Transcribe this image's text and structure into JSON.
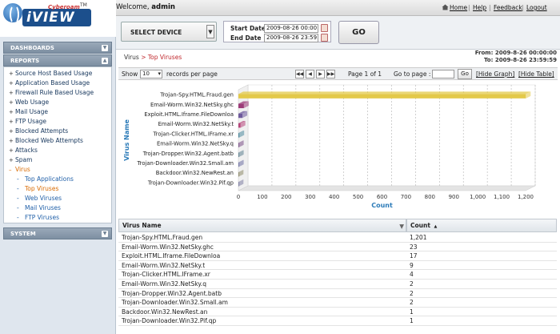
{
  "brand": {
    "name": "iVIEW",
    "maker": "Cyberoam",
    "tm": "TM"
  },
  "topbar": {
    "welcome_prefix": "Welcome,",
    "user": "admin",
    "links": [
      "Home",
      "Help",
      "Feedback",
      "Logout"
    ]
  },
  "sidebar": {
    "dashboards": "DASHBOARDS",
    "reports": "REPORTS",
    "system": "SYSTEM",
    "items": [
      "Source Host Based Usage",
      "Application Based Usage",
      "Firewall Rule Based Usage",
      "Web Usage",
      "Mail Usage",
      "FTP Usage",
      "Blocked Attempts",
      "Blocked Web Attempts",
      "Attacks",
      "Spam",
      "Virus"
    ],
    "virus_sub": [
      "Top Applications",
      "Top Viruses",
      "Web Viruses",
      "Mail Viruses",
      "FTP Viruses"
    ]
  },
  "selection": {
    "device_label": "SELECT DEVICE",
    "start_label": "Start Date",
    "start_value": "2009-08-26 00:00:00",
    "end_label": "End Date",
    "end_value": "2009-08-26 23:59:59",
    "go_label": "GO"
  },
  "report": {
    "crumb_parent": "Virus",
    "crumb_sep": ">",
    "crumb_current": "Top Viruses",
    "from": "From: 2009-8-26 00:00:00",
    "to": "To: 2009-8-26 23:59:59"
  },
  "pager": {
    "show": "Show",
    "per_page_value": "10",
    "records_label": "records per page",
    "page_info": "Page 1 of 1",
    "goto_label": "Go to page :",
    "go_btn": "Go",
    "hide_graph": "[Hide Graph]",
    "hide_table": "[Hide Table]"
  },
  "chart_data": {
    "type": "bar",
    "orientation": "horizontal",
    "title": "",
    "xlabel": "Count",
    "ylabel": "Virus Name",
    "xlim": [
      0,
      1200
    ],
    "xticks": [
      0,
      100,
      200,
      300,
      400,
      500,
      600,
      700,
      800,
      900,
      1000,
      1100,
      1200
    ],
    "tick_labels": [
      "0",
      "100",
      "200",
      "300",
      "400",
      "500",
      "600",
      "700",
      "800",
      "900",
      "1,000",
      "1,100",
      "1,200"
    ],
    "categories": [
      "Trojan-Spy.HTML.Fraud.gen",
      "Email-Worm.Win32.NetSky.ghc",
      "Exploit.HTML.Iframe.FileDownloa",
      "Email-Worm.Win32.NetSky.t",
      "Trojan-Clicker.HTML.IFrame.xr",
      "Email-Worm.Win32.NetSky.q",
      "Trojan-Dropper.Win32.Agent.batb",
      "Trojan-Downloader.Win32.Small.am",
      "Backdoor.Win32.NewRest.an",
      "Trojan-Downloader.Win32.Pif.qp"
    ],
    "tick_category_labels": [
      "Trojan-Spy.HTML.Fraud.gen",
      "Email-Worm.Win32.NetSky.ghc",
      "Exploit.HTML.Iframe.FileDownloa",
      "Email-Worm.Win32.NetSky.t",
      "Trojan-Clicker.HTML.IFrame.xr",
      "Email-Worm.Win32.NetSky.q",
      "Trojan-Dropper.Win32.Agent.batb",
      "Trojan-Downloader.Win32.Small.am",
      "Backdoor.Win32.NewRest.an",
      "Trojan-Downloader.Win32.Pif.qp"
    ],
    "values": [
      1201,
      23,
      17,
      9,
      4,
      2,
      2,
      2,
      1,
      1
    ],
    "colors": [
      "#e3c94a",
      "#9c3b78",
      "#6e5a9c",
      "#b6467b",
      "#4f8a9e",
      "#7a4e86",
      "#5d7f8f",
      "#6d6fa3",
      "#8e8a6a",
      "#7d7da3"
    ],
    "grid": true,
    "legend": "none"
  },
  "table": {
    "col1": "Virus Name",
    "col2": "Count",
    "rows": [
      [
        "Trojan-Spy.HTML.Fraud.gen",
        "1,201"
      ],
      [
        "Email-Worm.Win32.NetSky.ghc",
        "23"
      ],
      [
        "Exploit.HTML.Iframe.FileDownloa",
        "17"
      ],
      [
        "Email-Worm.Win32.NetSky.t",
        "9"
      ],
      [
        "Trojan-Clicker.HTML.IFrame.xr",
        "4"
      ],
      [
        "Email-Worm.Win32.NetSky.q",
        "2"
      ],
      [
        "Trojan-Dropper.Win32.Agent.batb",
        "2"
      ],
      [
        "Trojan-Downloader.Win32.Small.am",
        "2"
      ],
      [
        "Backdoor.Win32.NewRest.an",
        "1"
      ],
      [
        "Trojan-Downloader.Win32.Pif.qp",
        "1"
      ]
    ]
  }
}
